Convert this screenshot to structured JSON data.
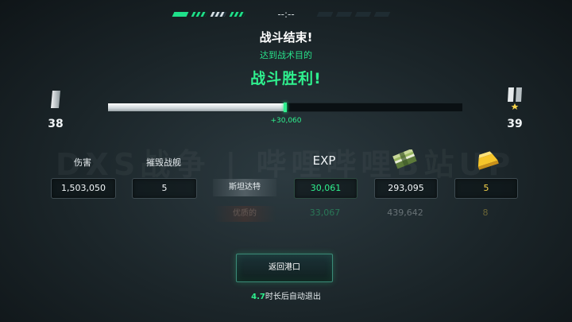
{
  "top": {
    "timer": "--:--"
  },
  "header": {
    "title": "战斗结束!",
    "subtitle": "达到战术目的",
    "result": "战斗胜利!"
  },
  "rank": {
    "current_level": "38",
    "next_level": "39",
    "progress": 0.5,
    "exp_gain": "+30,060"
  },
  "watermark": "DXS战争 | 哔哩哔哩B站UP",
  "columns": {
    "damage": "伤害",
    "destroyed": "摧毁战舰",
    "exp": "EXP"
  },
  "icons": {
    "credits": "cash-stack-icon",
    "gold": "gold-bar-icon",
    "rank": "rank-insignia-icon"
  },
  "stats": {
    "damage": "1,503,050",
    "destroyed": "5",
    "ship": "斯坦达特",
    "exp": "30,061",
    "credits": "293,095",
    "gold": "5"
  },
  "premium": {
    "label": "优质的",
    "exp": "33,067",
    "credits": "439,642",
    "gold": "8"
  },
  "actions": {
    "return_label": "返回港口",
    "auto_exit_seconds": "4.7",
    "auto_exit_suffix": "时长后自动退出"
  },
  "colors": {
    "accent": "#2ff08e",
    "gold": "#f6d34a",
    "background": "#1b2529"
  }
}
